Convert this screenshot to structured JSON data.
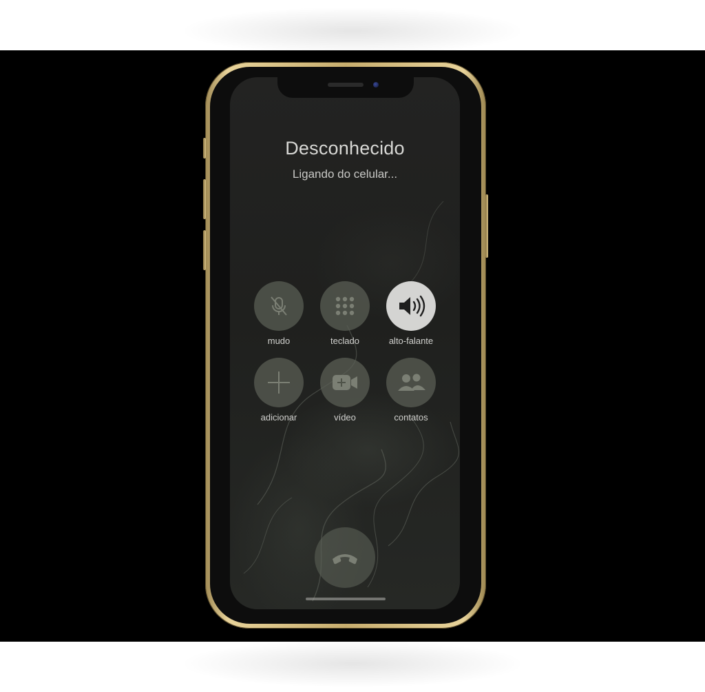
{
  "call": {
    "caller_name": "Desconhecido",
    "status": "Ligando do celular..."
  },
  "controls": [
    {
      "id": "mute",
      "label": "mudo",
      "icon": "microphone-slash-icon",
      "active": false
    },
    {
      "id": "keypad",
      "label": "teclado",
      "icon": "keypad-icon",
      "active": false
    },
    {
      "id": "speaker",
      "label": "alto-falante",
      "icon": "speaker-icon",
      "active": true
    },
    {
      "id": "add",
      "label": "adicionar",
      "icon": "plus-icon",
      "active": false
    },
    {
      "id": "video",
      "label": "vídeo",
      "icon": "video-camera-icon",
      "active": false
    },
    {
      "id": "contacts",
      "label": "contatos",
      "icon": "contacts-icon",
      "active": false
    }
  ],
  "end_call": {
    "icon": "phone-hangup-icon"
  },
  "colors": {
    "frame_gold": "#c7ad6e",
    "button_bg": "#5c6056",
    "active_button_bg": "#d4d4d2",
    "text": "#d9d9d6"
  }
}
